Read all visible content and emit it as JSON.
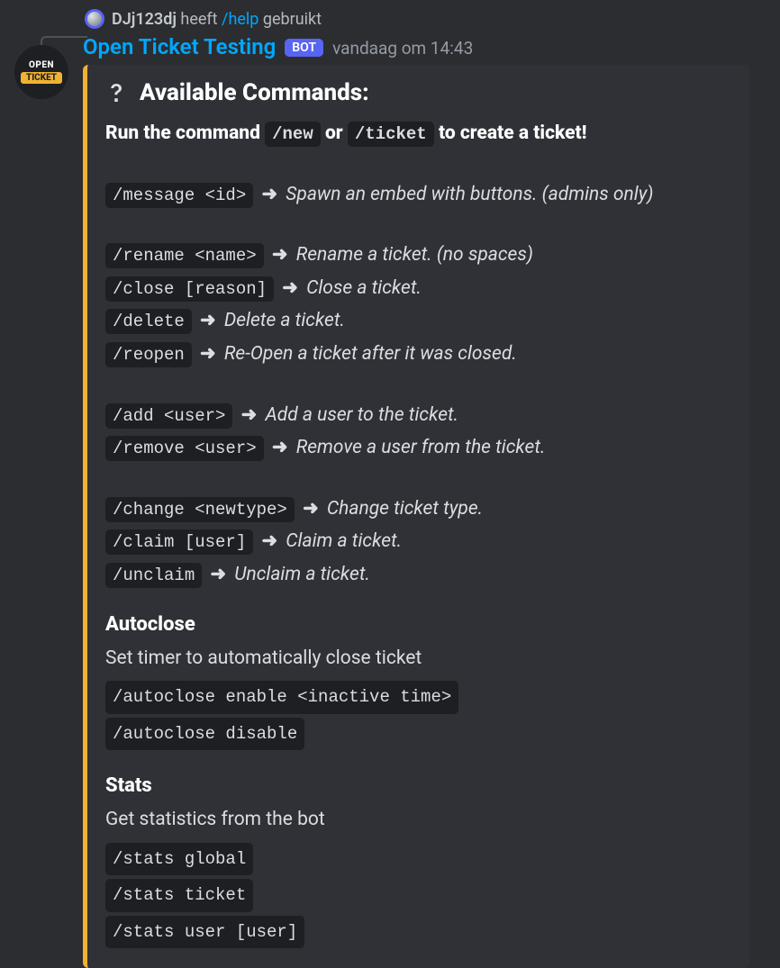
{
  "reply": {
    "user": "DJj123dj",
    "pre": "heeft",
    "command": "/help",
    "post": "gebruikt"
  },
  "header": {
    "botName": "Open Ticket Testing",
    "badge": "BOT",
    "timestamp": "vandaag om 14:43"
  },
  "avatar": {
    "line1": "OPEN",
    "line2": "TICKET"
  },
  "embed": {
    "title": "Available Commands:",
    "intro": {
      "pre": "Run the command",
      "cmd1": "/new",
      "mid": "or",
      "cmd2": "/ticket",
      "post": "to create a ticket!"
    },
    "arrow": "➜",
    "groups": [
      [
        {
          "cmd": "/message <id>",
          "desc": "Spawn an embed with buttons. (admins only)"
        }
      ],
      [
        {
          "cmd": "/rename <name>",
          "desc": "Rename a ticket. (no spaces)"
        },
        {
          "cmd": "/close [reason]",
          "desc": "Close a ticket."
        },
        {
          "cmd": "/delete",
          "desc": "Delete a ticket."
        },
        {
          "cmd": "/reopen",
          "desc": "Re-Open a ticket after it was closed."
        }
      ],
      [
        {
          "cmd": "/add <user>",
          "desc": "Add a user to the ticket."
        },
        {
          "cmd": "/remove <user>",
          "desc": "Remove a user from the ticket."
        }
      ],
      [
        {
          "cmd": "/change <newtype>",
          "desc": "Change ticket type."
        },
        {
          "cmd": "/claim [user]",
          "desc": "Claim a ticket."
        },
        {
          "cmd": "/unclaim",
          "desc": "Unclaim a ticket."
        }
      ]
    ],
    "sections": [
      {
        "title": "Autoclose",
        "sub": "Set timer to automatically close ticket",
        "codes": [
          "/autoclose enable <inactive time>",
          "/autoclose disable"
        ]
      },
      {
        "title": "Stats",
        "sub": "Get statistics from the bot",
        "codes": [
          "/stats global",
          "/stats ticket",
          "/stats user [user]"
        ]
      }
    ]
  }
}
